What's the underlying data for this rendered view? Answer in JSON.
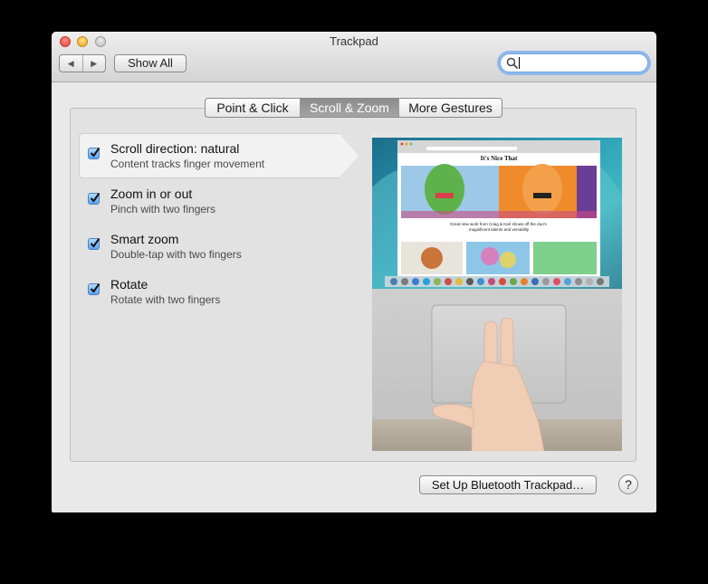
{
  "window": {
    "title": "Trackpad"
  },
  "toolbar": {
    "show_all_label": "Show All",
    "back_icon": "◀",
    "forward_icon": "▶",
    "search_value": ""
  },
  "tabs": [
    {
      "label": "Point & Click",
      "active": false
    },
    {
      "label": "Scroll & Zoom",
      "active": true
    },
    {
      "label": "More Gestures",
      "active": false
    }
  ],
  "options": [
    {
      "title": "Scroll direction: natural",
      "subtitle": "Content tracks finger movement",
      "checked": true,
      "selected": true
    },
    {
      "title": "Zoom in or out",
      "subtitle": "Pinch with two fingers",
      "checked": true,
      "selected": false
    },
    {
      "title": "Smart zoom",
      "subtitle": "Double-tap with two fingers",
      "checked": true,
      "selected": false
    },
    {
      "title": "Rotate",
      "subtitle": "Rotate with two fingers",
      "checked": true,
      "selected": false
    }
  ],
  "preview": {
    "site_name": "It's Nice That",
    "headline": "Great new work from Craig & Karl shows off the duo's magnificent talents and versatility"
  },
  "footer": {
    "bluetooth_button_label": "Set Up Bluetooth Trackpad…",
    "help_label": "?"
  },
  "colors": {
    "accent": "#5aa4ef",
    "window_bg": "#e9e9e9",
    "tab_active": "#999999",
    "search_focus": "#8eb9ec"
  }
}
